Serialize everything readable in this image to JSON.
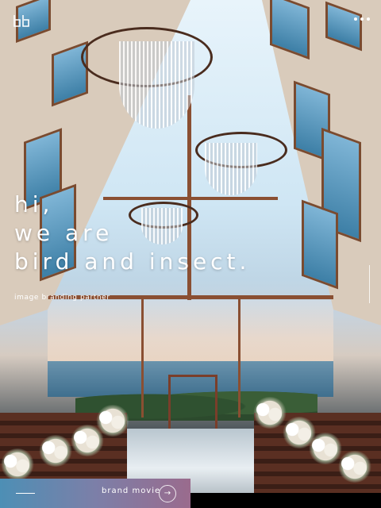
{
  "header": {
    "logo_icon": "bird-and-insect-logo-icon",
    "menu_icon": "more-dots-icon"
  },
  "hero": {
    "headline_lines": [
      "hi,",
      "we are",
      "bird and insect."
    ],
    "tagline": "image branding partner"
  },
  "bottom_bar": {
    "label": "brand movie",
    "button_icon": "arrow-right-icon",
    "button_glyph": "→"
  },
  "colors": {
    "bar_gradient_start": "#4d8fb5",
    "bar_gradient_end": "#9a6b8d",
    "text": "#ffffff"
  }
}
